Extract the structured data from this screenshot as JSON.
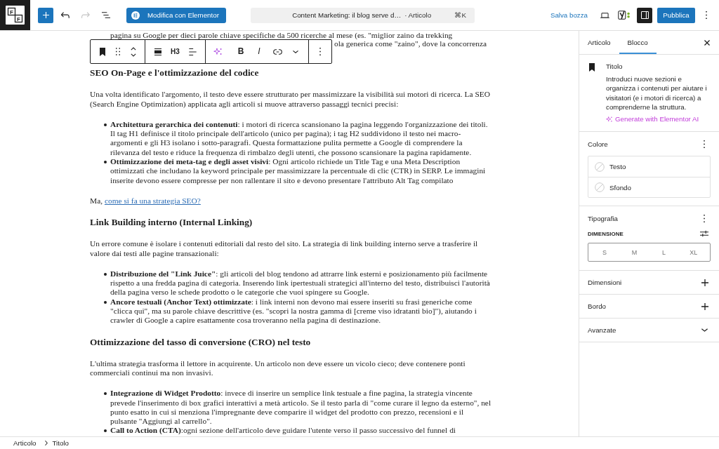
{
  "top_bar": {
    "logo": {
      "letters": [
        "F",
        "F"
      ]
    },
    "tools": [
      {
        "kind": "add",
        "disabled": false
      },
      {
        "kind": "undo",
        "disabled": false
      },
      {
        "kind": "redo",
        "disabled": true
      },
      {
        "kind": "list-view",
        "disabled": false
      }
    ],
    "editor_button": {
      "label": "Modifica con Elementor"
    },
    "command_bar": {
      "title": "Content Marketing: il blog serve d…",
      "type": "· Articolo",
      "shortcut": "⌘K"
    },
    "save_draft": "Salva bozza",
    "actions": [
      {
        "kind": "preview"
      },
      {
        "kind": "seo"
      }
    ],
    "settings_toggle": {
      "pressed": true
    },
    "publish": "Pubblica"
  },
  "block_toolbar": {
    "groups": [
      [
        {
          "kind": "block-type"
        },
        {
          "kind": "drag"
        },
        {
          "kind": "move"
        }
      ],
      [
        {
          "kind": "align"
        },
        {
          "kind": "level",
          "label": "H3"
        },
        {
          "kind": "text-align"
        }
      ],
      [
        {
          "kind": "ai"
        },
        {
          "kind": "bold",
          "label": "B"
        },
        {
          "kind": "italic",
          "label": "I"
        },
        {
          "kind": "link"
        },
        {
          "kind": "more"
        }
      ],
      [
        {
          "kind": "options"
        }
      ]
    ]
  },
  "document": {
    "blocks": [
      {
        "kind": "fragment",
        "lines": [
          "pagina su Google per dieci parole chiave specifiche da 500 ricerche al mese (es. \"miglior zaino da trekking",
          "ola generica come \"zaino\", dove la concorrenza"
        ]
      },
      {
        "kind": "heading",
        "text": "SEO On-Page e l'ottimizzazione del codice"
      },
      {
        "kind": "paragraph",
        "text": "Una volta identificato l'argomento, il testo deve essere strutturato per massimizzare la visibilità sui motori di ricerca. La SEO (Search Engine Optimization) applicata agli articoli si muove attraverso passaggi tecnici precisi:"
      },
      {
        "kind": "list",
        "items": [
          "**Architettura gerarchica dei contenuti**: i motori di ricerca scansionano la pagina leggendo l'organizzazione dei titoli. Il tag H1 definisce il titolo principale dell'articolo (unico per pagina); i tag H2 suddividono il testo nei macro-argomenti e gli H3 isolano i sotto-paragrafi. Questa formattazione pulita permette a Google di comprendere la rilevanza del testo e riduce la frequenza di rimbalzo degli utenti, che possono scansionare la pagina rapidamente.",
          "**Ottimizzazione dei meta-tag e degli asset visivi**: Ogni articolo richiede un Title Tag e una Meta Description ottimizzati che includano la keyword principale per massimizzare la percentuale di clic (CTR) in SERP. Le immagini inserite devono essere compresse per non rallentare il sito e devono presentare l'attributo Alt Tag compilato"
        ]
      },
      {
        "kind": "paragraph",
        "text": "Ma,",
        "link": "come si fa una strategia SEO?"
      },
      {
        "kind": "heading",
        "text": "Link Building interno (Internal Linking)"
      },
      {
        "kind": "paragraph",
        "text": "Un errore comune è isolare i contenuti editoriali dal resto del sito. La strategia di link building interno serve a trasferire il valore dai testi alle pagine transazionali:"
      },
      {
        "kind": "list",
        "items": [
          "**Distribuzione del \"Link Juice\"**: gli articoli del blog tendono ad attrarre link esterni e posizionamento più facilmente rispetto a una fredda pagina di categoria. Inserendo link ipertestuali strategici all'interno del testo, distribuisci l'autorità della pagina verso le schede prodotto o le categorie che vuoi spingere su Google.",
          "**Ancore testuali (Anchor Text) ottimizzate**: i link interni non devono mai essere inseriti su frasi generiche come \"clicca qui\", ma su parole chiave descrittive (es. \"scopri la nostra gamma di [creme viso idratanti bio]\"), aiutando i crawler di Google a capire esattamente cosa troveranno nella pagina di destinazione."
        ]
      },
      {
        "kind": "heading",
        "text": "Ottimizzazione del tasso di conversione (CRO) nel testo"
      },
      {
        "kind": "paragraph",
        "text": "L'ultima strategia trasforma il lettore in acquirente. Un articolo non deve essere un vicolo cieco; deve contenere ponti commerciali continui ma non invasivi."
      },
      {
        "kind": "list",
        "items": [
          "**Integrazione di Widget Prodotto**: invece di inserire un semplice link testuale a fine pagina, la strategia vincente prevede l'inserimento di box grafici interattivi a metà articolo. Se il testo parla di \"come curare il legno da esterno\", nel punto esatto in cui si menziona l'impregnante deve comparire il widget del prodotto con prezzo, recensioni e il pulsante \"Aggiungi al carrello\".",
          "**Call to Action (CTA)**:ogni sezione dell'articolo deve guidare l'utente verso il passo successivo del funnel di"
        ]
      }
    ]
  },
  "sidebar": {
    "tabs": [
      {
        "label": "Articolo",
        "selected": false
      },
      {
        "label": "Blocco",
        "selected": true
      }
    ],
    "block_card": {
      "title": "Titolo",
      "description": "Introduci nuove sezioni e organizza i contenuti per aiutare i visitatori (e i motori di ricerca) a comprenderne la struttura.",
      "ai_link": "Generate with Elementor AI"
    },
    "panels": [
      {
        "kind": "color",
        "title": "Colore",
        "items": [
          "Testo",
          "Sfondo"
        ]
      },
      {
        "kind": "typography",
        "title": "Tipografia",
        "label": "DIMENSIONE",
        "sizes": [
          {
            "label": "S",
            "selected": false
          },
          {
            "label": "M",
            "selected": false
          },
          {
            "label": "L",
            "selected": false
          },
          {
            "label": "XL",
            "selected": false
          }
        ]
      },
      {
        "kind": "tools",
        "title": "Dimensioni"
      },
      {
        "kind": "tools",
        "title": "Bordo"
      },
      {
        "kind": "collapsed",
        "title": "Avanzate"
      }
    ]
  },
  "breadcrumb": [
    "Articolo",
    "Titolo"
  ]
}
